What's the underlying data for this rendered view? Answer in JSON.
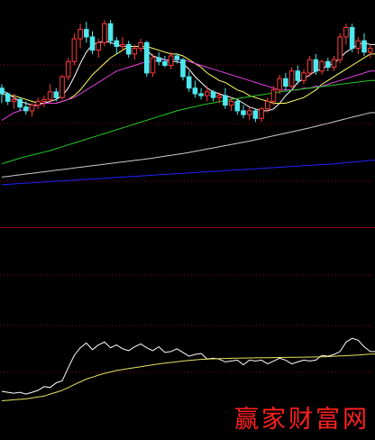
{
  "watermark": "赢家财富网",
  "colors": {
    "background": "#000000",
    "grid": "#9a0000",
    "divider": "#8a0000",
    "up_candle": "#ff3a3a",
    "down_candle": "#4ee8ee",
    "ma5": "#ffffff",
    "ma10": "#ffff66",
    "ma20": "#e040e0",
    "ma60": "#22cc22",
    "ma120": "#cccccc",
    "ma250": "#2222ff",
    "indicator_fast": "#ffffff",
    "indicator_slow": "#e8e060"
  },
  "chart_data": [
    {
      "type": "candlestick",
      "title": "",
      "grid": true,
      "ylim": [
        0,
        100
      ],
      "candles": [
        {
          "o": 63,
          "h": 65,
          "l": 55,
          "c": 60
        },
        {
          "o": 60,
          "h": 61,
          "l": 54,
          "c": 56
        },
        {
          "o": 56,
          "h": 60,
          "l": 52,
          "c": 57
        },
        {
          "o": 57,
          "h": 58,
          "l": 51,
          "c": 53
        },
        {
          "o": 53,
          "h": 56,
          "l": 49,
          "c": 51
        },
        {
          "o": 51,
          "h": 55,
          "l": 48,
          "c": 54
        },
        {
          "o": 54,
          "h": 58,
          "l": 52,
          "c": 56
        },
        {
          "o": 56,
          "h": 59,
          "l": 53,
          "c": 57
        },
        {
          "o": 57,
          "h": 65,
          "l": 55,
          "c": 61
        },
        {
          "o": 61,
          "h": 63,
          "l": 56,
          "c": 58
        },
        {
          "o": 58,
          "h": 70,
          "l": 57,
          "c": 69
        },
        {
          "o": 69,
          "h": 79,
          "l": 67,
          "c": 77
        },
        {
          "o": 77,
          "h": 92,
          "l": 75,
          "c": 89
        },
        {
          "o": 89,
          "h": 97,
          "l": 84,
          "c": 94
        },
        {
          "o": 94,
          "h": 98,
          "l": 87,
          "c": 90
        },
        {
          "o": 90,
          "h": 93,
          "l": 81,
          "c": 83
        },
        {
          "o": 83,
          "h": 89,
          "l": 79,
          "c": 87
        },
        {
          "o": 87,
          "h": 99,
          "l": 85,
          "c": 97
        },
        {
          "o": 97,
          "h": 99,
          "l": 86,
          "c": 88
        },
        {
          "o": 88,
          "h": 90,
          "l": 81,
          "c": 85
        },
        {
          "o": 85,
          "h": 90,
          "l": 83,
          "c": 86
        },
        {
          "o": 86,
          "h": 88,
          "l": 79,
          "c": 81
        },
        {
          "o": 81,
          "h": 86,
          "l": 78,
          "c": 84
        },
        {
          "o": 84,
          "h": 89,
          "l": 82,
          "c": 87
        },
        {
          "o": 87,
          "h": 88,
          "l": 69,
          "c": 71
        },
        {
          "o": 71,
          "h": 81,
          "l": 69,
          "c": 79
        },
        {
          "o": 79,
          "h": 82,
          "l": 75,
          "c": 77
        },
        {
          "o": 77,
          "h": 80,
          "l": 74,
          "c": 75
        },
        {
          "o": 75,
          "h": 82,
          "l": 73,
          "c": 80
        },
        {
          "o": 80,
          "h": 81,
          "l": 76,
          "c": 78
        },
        {
          "o": 78,
          "h": 79,
          "l": 67,
          "c": 69
        },
        {
          "o": 69,
          "h": 72,
          "l": 61,
          "c": 63
        },
        {
          "o": 63,
          "h": 67,
          "l": 58,
          "c": 60
        },
        {
          "o": 60,
          "h": 63,
          "l": 57,
          "c": 59
        },
        {
          "o": 59,
          "h": 64,
          "l": 56,
          "c": 61
        },
        {
          "o": 61,
          "h": 62,
          "l": 56,
          "c": 58
        },
        {
          "o": 58,
          "h": 61,
          "l": 55,
          "c": 59
        },
        {
          "o": 59,
          "h": 63,
          "l": 52,
          "c": 54
        },
        {
          "o": 54,
          "h": 58,
          "l": 51,
          "c": 56
        },
        {
          "o": 56,
          "h": 57,
          "l": 49,
          "c": 51
        },
        {
          "o": 51,
          "h": 54,
          "l": 47,
          "c": 49
        },
        {
          "o": 49,
          "h": 53,
          "l": 46,
          "c": 51
        },
        {
          "o": 51,
          "h": 52,
          "l": 45,
          "c": 47
        },
        {
          "o": 47,
          "h": 53,
          "l": 45,
          "c": 52
        },
        {
          "o": 52,
          "h": 58,
          "l": 50,
          "c": 56
        },
        {
          "o": 56,
          "h": 64,
          "l": 54,
          "c": 62
        },
        {
          "o": 62,
          "h": 70,
          "l": 60,
          "c": 68
        },
        {
          "o": 68,
          "h": 71,
          "l": 62,
          "c": 64
        },
        {
          "o": 64,
          "h": 74,
          "l": 63,
          "c": 72
        },
        {
          "o": 72,
          "h": 75,
          "l": 65,
          "c": 67
        },
        {
          "o": 67,
          "h": 73,
          "l": 65,
          "c": 71
        },
        {
          "o": 71,
          "h": 80,
          "l": 69,
          "c": 78
        },
        {
          "o": 78,
          "h": 81,
          "l": 70,
          "c": 72
        },
        {
          "o": 72,
          "h": 78,
          "l": 70,
          "c": 77
        },
        {
          "o": 77,
          "h": 79,
          "l": 72,
          "c": 74
        },
        {
          "o": 74,
          "h": 80,
          "l": 72,
          "c": 78
        },
        {
          "o": 78,
          "h": 92,
          "l": 76,
          "c": 90
        },
        {
          "o": 90,
          "h": 97,
          "l": 86,
          "c": 95
        },
        {
          "o": 95,
          "h": 97,
          "l": 82,
          "c": 84
        },
        {
          "o": 84,
          "h": 90,
          "l": 81,
          "c": 88
        },
        {
          "o": 88,
          "h": 92,
          "l": 80,
          "c": 82
        },
        {
          "o": 82,
          "h": 86,
          "l": 79,
          "c": 84
        }
      ],
      "series": [
        {
          "key": "ma5",
          "values": [
            62,
            60,
            58,
            56,
            55,
            54,
            54,
            55,
            56,
            57,
            59,
            63,
            69,
            76,
            82,
            86,
            87,
            88,
            87,
            86,
            85,
            85,
            85,
            85,
            83,
            80,
            79,
            78,
            77,
            77,
            76,
            73,
            69,
            66,
            63,
            61,
            60,
            59,
            58,
            57,
            55,
            53,
            52,
            51,
            51,
            52,
            55,
            59,
            62,
            66,
            68,
            70,
            72,
            73,
            75,
            76,
            79,
            82,
            84,
            86,
            87,
            86
          ]
        },
        {
          "key": "ma10",
          "values": [
            60,
            59,
            59,
            58,
            57,
            56,
            55,
            55,
            55,
            55,
            56,
            57,
            59,
            62,
            66,
            70,
            73,
            76,
            79,
            81,
            83,
            85,
            85,
            85,
            85,
            84,
            83,
            82,
            81,
            81,
            80,
            78,
            76,
            74,
            71,
            69,
            67,
            66,
            64,
            62,
            61,
            59,
            58,
            57,
            56,
            55,
            55,
            55,
            56,
            57,
            58,
            60,
            62,
            65,
            67,
            69,
            71,
            73,
            75,
            77,
            79,
            81
          ]
        },
        {
          "key": "ma20",
          "values": [
            46,
            48,
            50,
            51,
            52,
            53,
            54,
            55,
            55,
            55,
            56,
            57,
            58,
            60,
            62,
            64,
            66,
            68,
            70,
            72,
            73,
            74,
            75,
            76,
            77,
            77,
            78,
            78,
            78,
            78,
            78,
            77,
            76,
            75,
            74,
            73,
            72,
            71,
            70,
            69,
            68,
            67,
            66,
            65,
            64,
            63,
            62,
            62,
            62,
            62,
            63,
            63,
            64,
            64,
            65,
            66,
            67,
            68,
            69,
            70,
            71,
            72
          ]
        },
        {
          "key": "ma60",
          "values": [
            23,
            24,
            25,
            26,
            26.8,
            27.6,
            28.4,
            29.2,
            30,
            31,
            32,
            33,
            34,
            35,
            36,
            37,
            38,
            39,
            40,
            41,
            42,
            43,
            44,
            45,
            46,
            47,
            48,
            49,
            50,
            51,
            51.8,
            52.5,
            53.2,
            54,
            54.6,
            55.2,
            55.8,
            56.4,
            57,
            57.5,
            58,
            58.5,
            59,
            59.5,
            60,
            60.5,
            61,
            61.4,
            61.8,
            62.2,
            62.6,
            63,
            63.4,
            63.8,
            64.2,
            64.6,
            65,
            65.4,
            65.8,
            66.2,
            66.6,
            67
          ]
        },
        {
          "key": "ma120",
          "values": [
            16,
            16.4,
            16.8,
            17.2,
            17.6,
            18,
            18.4,
            18.8,
            19.2,
            19.6,
            20,
            20.4,
            20.8,
            21.2,
            21.6,
            22,
            22.4,
            22.8,
            23.2,
            23.6,
            24,
            24.4,
            24.8,
            25.2,
            25.6,
            26,
            26.5,
            27,
            27.5,
            28,
            28.5,
            29,
            29.6,
            30.2,
            30.8,
            31.4,
            32,
            32.6,
            33.2,
            33.8,
            34.4,
            35,
            35.7,
            36.4,
            37.1,
            37.8,
            38.5,
            39.2,
            39.9,
            40.6,
            41.3,
            42,
            42.8,
            43.6,
            44.4,
            45.2,
            46,
            46.8,
            47.6,
            48.4,
            49.2,
            50
          ]
        },
        {
          "key": "ma250",
          "values": [
            12,
            12.2,
            12.4,
            12.6,
            12.8,
            13,
            13.2,
            13.4,
            13.6,
            13.8,
            14,
            14.2,
            14.4,
            14.6,
            14.8,
            15,
            15.2,
            15.4,
            15.6,
            15.8,
            16,
            16.2,
            16.4,
            16.6,
            16.8,
            17,
            17.2,
            17.4,
            17.6,
            17.8,
            18,
            18.2,
            18.4,
            18.6,
            18.8,
            19,
            19.2,
            19.4,
            19.6,
            19.8,
            20,
            20.2,
            20.4,
            20.6,
            20.8,
            21,
            21.2,
            21.4,
            21.6,
            21.8,
            22,
            22.2,
            22.4,
            22.6,
            22.8,
            23,
            23.3,
            23.6,
            23.9,
            24.2,
            24.5,
            24.8
          ]
        }
      ]
    },
    {
      "type": "line",
      "title": "",
      "grid": true,
      "ylim": [
        0,
        100
      ],
      "series": [
        {
          "key": "indicator_fast",
          "values": [
            20,
            19,
            18,
            19,
            17,
            19,
            21,
            25,
            24,
            29,
            31,
            45,
            58,
            66,
            71,
            64,
            69,
            72,
            66,
            69,
            65,
            63,
            67,
            70,
            66,
            63,
            67,
            61,
            62,
            65,
            61,
            57,
            59,
            60,
            54,
            55,
            54,
            51,
            52,
            53,
            48,
            53,
            52,
            53,
            49,
            52,
            55,
            53,
            49,
            51,
            53,
            52,
            53,
            58,
            57,
            59,
            62,
            72,
            76,
            74,
            67,
            62
          ]
        },
        {
          "key": "indicator_slow",
          "values": [
            10,
            10.5,
            11,
            11.5,
            12,
            13,
            14,
            15,
            17,
            19,
            21,
            24,
            27,
            30,
            33,
            35,
            37,
            39,
            40.5,
            42,
            43,
            44,
            45,
            46,
            47,
            48,
            49,
            49.8,
            50.5,
            51.2,
            52,
            52.6,
            53.2,
            53.7,
            54,
            54.3,
            54.5,
            54.7,
            54.9,
            55,
            55.1,
            55.2,
            55.3,
            55.4,
            55.5,
            55.6,
            55.7,
            55.8,
            55.9,
            56,
            56.1,
            56.2,
            56.3,
            56.5,
            56.7,
            57,
            57.3,
            57.6,
            58,
            58.4,
            58.8,
            59.2
          ]
        }
      ]
    }
  ]
}
